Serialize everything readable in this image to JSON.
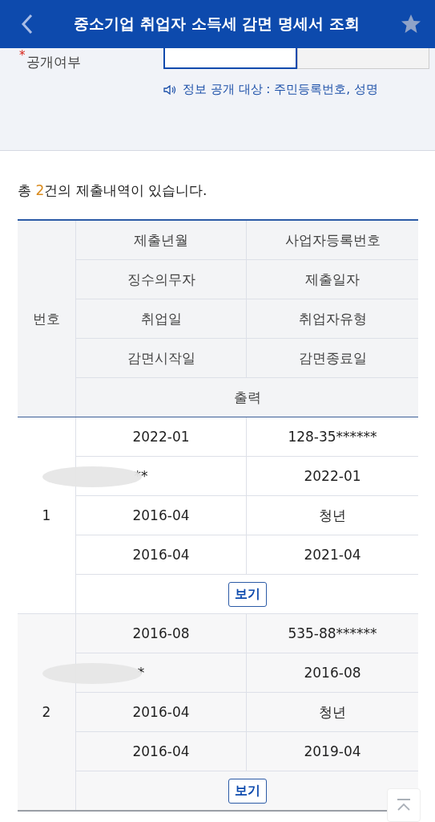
{
  "header": {
    "title": "중소기업 취업자 소득세 감면 명세서 조회"
  },
  "disclosure": {
    "required_mark": "*",
    "label": "공개여부",
    "options": [
      {
        "selected": true
      },
      {
        "selected": false
      }
    ],
    "notice": "정보 공개 대상 : 주민등록번호, 성명"
  },
  "summary": {
    "prefix": "총 ",
    "count": "2",
    "suffix": "건의 제출내역이 있습니다."
  },
  "table": {
    "number_heading": "번호",
    "column_pairs": [
      [
        "제출년월",
        "사업자등록번호"
      ],
      [
        "징수의무자",
        "제출일자"
      ],
      [
        "취업일",
        "취업자유형"
      ],
      [
        "감면시작일",
        "감면종료일"
      ]
    ],
    "output_heading": "출력",
    "records": [
      {
        "number": "1",
        "redacted": true,
        "cells": [
          [
            "2022-01",
            "128-35******"
          ],
          [
            "**",
            "2022-01"
          ],
          [
            "2016-04",
            "청년"
          ],
          [
            "2016-04",
            "2021-04"
          ]
        ],
        "action": "보기"
      },
      {
        "number": "2",
        "redacted": true,
        "cells": [
          [
            "2016-08",
            "535-88******"
          ],
          [
            "*",
            "2016-08"
          ],
          [
            "2016-04",
            "청년"
          ],
          [
            "2016-04",
            "2019-04"
          ]
        ],
        "action": "보기"
      }
    ]
  }
}
